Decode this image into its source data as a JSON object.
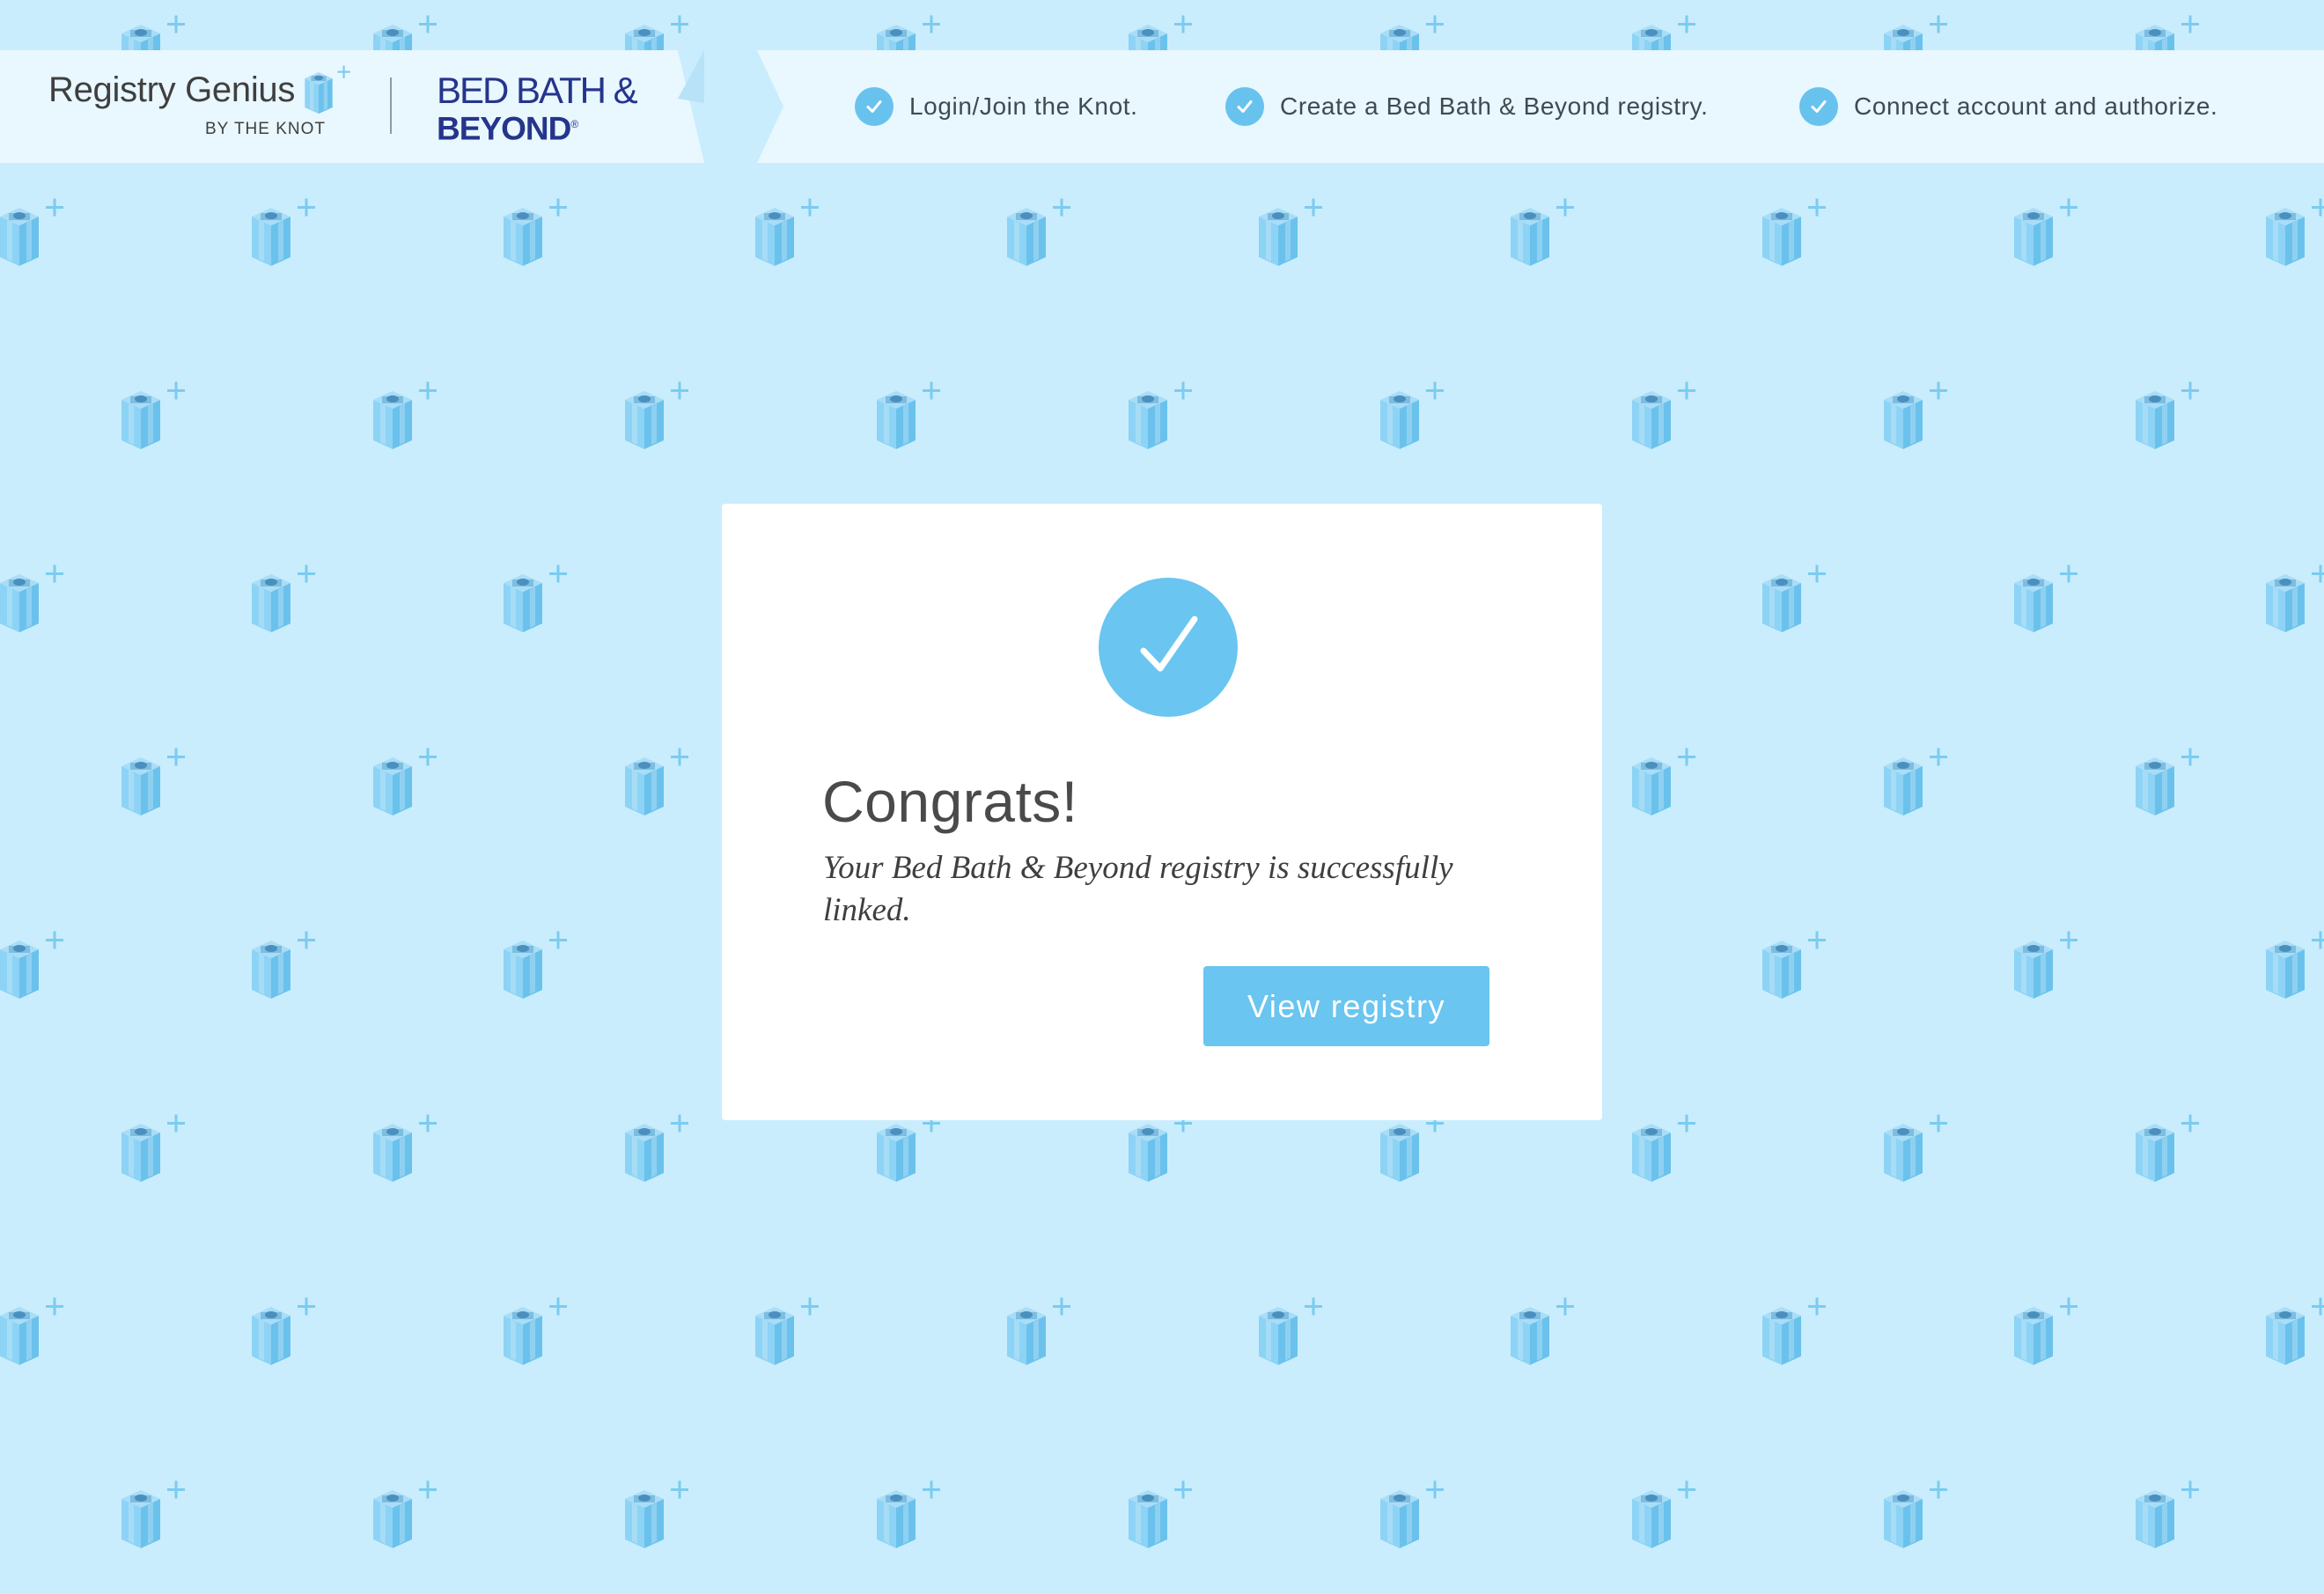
{
  "header": {
    "brand": {
      "name": "Registry Genius",
      "byline": "BY THE KNOT",
      "icon": "gift-box-plus-icon"
    },
    "partner": {
      "line1": "BED BATH &",
      "line2": "BEYOND",
      "mark": "®"
    },
    "steps": [
      {
        "label": "Login/Join the Knot.",
        "status": "complete",
        "icon": "check-circle-icon"
      },
      {
        "label": "Create a Bed Bath & Beyond registry.",
        "status": "complete",
        "icon": "check-circle-icon"
      },
      {
        "label": "Connect account and authorize.",
        "status": "complete",
        "icon": "check-circle-icon"
      }
    ]
  },
  "dialog": {
    "icon": "success-check-icon",
    "title": "Congrats!",
    "message": "Your Bed Bath & Beyond registry is successfully linked.",
    "button_label": "View registry"
  },
  "background": {
    "icon": "gift-box-plus-icon"
  },
  "colors": {
    "background": "#c9edfd",
    "banner": "#e9f7fe",
    "accent": "#6ac5f0",
    "partner_brand": "#25358c",
    "text": "#3f3f3f"
  }
}
